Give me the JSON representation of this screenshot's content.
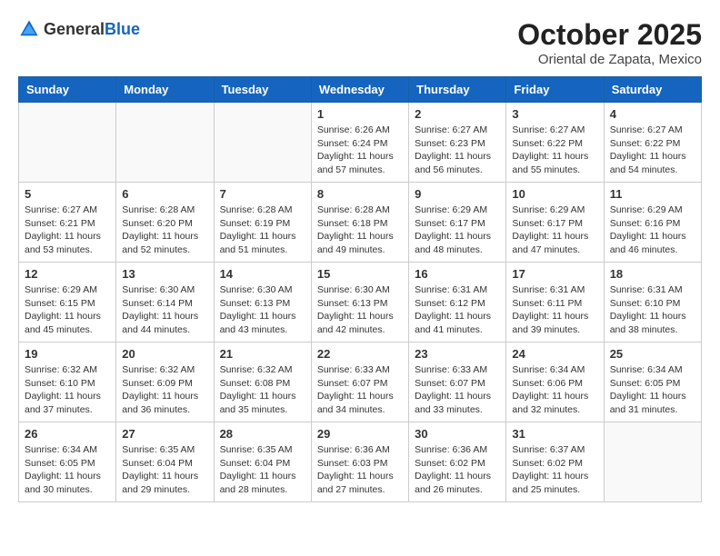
{
  "header": {
    "logo_general": "General",
    "logo_blue": "Blue",
    "month_title": "October 2025",
    "subtitle": "Oriental de Zapata, Mexico"
  },
  "days_of_week": [
    "Sunday",
    "Monday",
    "Tuesday",
    "Wednesday",
    "Thursday",
    "Friday",
    "Saturday"
  ],
  "weeks": [
    [
      {
        "day": "",
        "info": ""
      },
      {
        "day": "",
        "info": ""
      },
      {
        "day": "",
        "info": ""
      },
      {
        "day": "1",
        "info": "Sunrise: 6:26 AM\nSunset: 6:24 PM\nDaylight: 11 hours and 57 minutes."
      },
      {
        "day": "2",
        "info": "Sunrise: 6:27 AM\nSunset: 6:23 PM\nDaylight: 11 hours and 56 minutes."
      },
      {
        "day": "3",
        "info": "Sunrise: 6:27 AM\nSunset: 6:22 PM\nDaylight: 11 hours and 55 minutes."
      },
      {
        "day": "4",
        "info": "Sunrise: 6:27 AM\nSunset: 6:22 PM\nDaylight: 11 hours and 54 minutes."
      }
    ],
    [
      {
        "day": "5",
        "info": "Sunrise: 6:27 AM\nSunset: 6:21 PM\nDaylight: 11 hours and 53 minutes."
      },
      {
        "day": "6",
        "info": "Sunrise: 6:28 AM\nSunset: 6:20 PM\nDaylight: 11 hours and 52 minutes."
      },
      {
        "day": "7",
        "info": "Sunrise: 6:28 AM\nSunset: 6:19 PM\nDaylight: 11 hours and 51 minutes."
      },
      {
        "day": "8",
        "info": "Sunrise: 6:28 AM\nSunset: 6:18 PM\nDaylight: 11 hours and 49 minutes."
      },
      {
        "day": "9",
        "info": "Sunrise: 6:29 AM\nSunset: 6:17 PM\nDaylight: 11 hours and 48 minutes."
      },
      {
        "day": "10",
        "info": "Sunrise: 6:29 AM\nSunset: 6:17 PM\nDaylight: 11 hours and 47 minutes."
      },
      {
        "day": "11",
        "info": "Sunrise: 6:29 AM\nSunset: 6:16 PM\nDaylight: 11 hours and 46 minutes."
      }
    ],
    [
      {
        "day": "12",
        "info": "Sunrise: 6:29 AM\nSunset: 6:15 PM\nDaylight: 11 hours and 45 minutes."
      },
      {
        "day": "13",
        "info": "Sunrise: 6:30 AM\nSunset: 6:14 PM\nDaylight: 11 hours and 44 minutes."
      },
      {
        "day": "14",
        "info": "Sunrise: 6:30 AM\nSunset: 6:13 PM\nDaylight: 11 hours and 43 minutes."
      },
      {
        "day": "15",
        "info": "Sunrise: 6:30 AM\nSunset: 6:13 PM\nDaylight: 11 hours and 42 minutes."
      },
      {
        "day": "16",
        "info": "Sunrise: 6:31 AM\nSunset: 6:12 PM\nDaylight: 11 hours and 41 minutes."
      },
      {
        "day": "17",
        "info": "Sunrise: 6:31 AM\nSunset: 6:11 PM\nDaylight: 11 hours and 39 minutes."
      },
      {
        "day": "18",
        "info": "Sunrise: 6:31 AM\nSunset: 6:10 PM\nDaylight: 11 hours and 38 minutes."
      }
    ],
    [
      {
        "day": "19",
        "info": "Sunrise: 6:32 AM\nSunset: 6:10 PM\nDaylight: 11 hours and 37 minutes."
      },
      {
        "day": "20",
        "info": "Sunrise: 6:32 AM\nSunset: 6:09 PM\nDaylight: 11 hours and 36 minutes."
      },
      {
        "day": "21",
        "info": "Sunrise: 6:32 AM\nSunset: 6:08 PM\nDaylight: 11 hours and 35 minutes."
      },
      {
        "day": "22",
        "info": "Sunrise: 6:33 AM\nSunset: 6:07 PM\nDaylight: 11 hours and 34 minutes."
      },
      {
        "day": "23",
        "info": "Sunrise: 6:33 AM\nSunset: 6:07 PM\nDaylight: 11 hours and 33 minutes."
      },
      {
        "day": "24",
        "info": "Sunrise: 6:34 AM\nSunset: 6:06 PM\nDaylight: 11 hours and 32 minutes."
      },
      {
        "day": "25",
        "info": "Sunrise: 6:34 AM\nSunset: 6:05 PM\nDaylight: 11 hours and 31 minutes."
      }
    ],
    [
      {
        "day": "26",
        "info": "Sunrise: 6:34 AM\nSunset: 6:05 PM\nDaylight: 11 hours and 30 minutes."
      },
      {
        "day": "27",
        "info": "Sunrise: 6:35 AM\nSunset: 6:04 PM\nDaylight: 11 hours and 29 minutes."
      },
      {
        "day": "28",
        "info": "Sunrise: 6:35 AM\nSunset: 6:04 PM\nDaylight: 11 hours and 28 minutes."
      },
      {
        "day": "29",
        "info": "Sunrise: 6:36 AM\nSunset: 6:03 PM\nDaylight: 11 hours and 27 minutes."
      },
      {
        "day": "30",
        "info": "Sunrise: 6:36 AM\nSunset: 6:02 PM\nDaylight: 11 hours and 26 minutes."
      },
      {
        "day": "31",
        "info": "Sunrise: 6:37 AM\nSunset: 6:02 PM\nDaylight: 11 hours and 25 minutes."
      },
      {
        "day": "",
        "info": ""
      }
    ]
  ]
}
